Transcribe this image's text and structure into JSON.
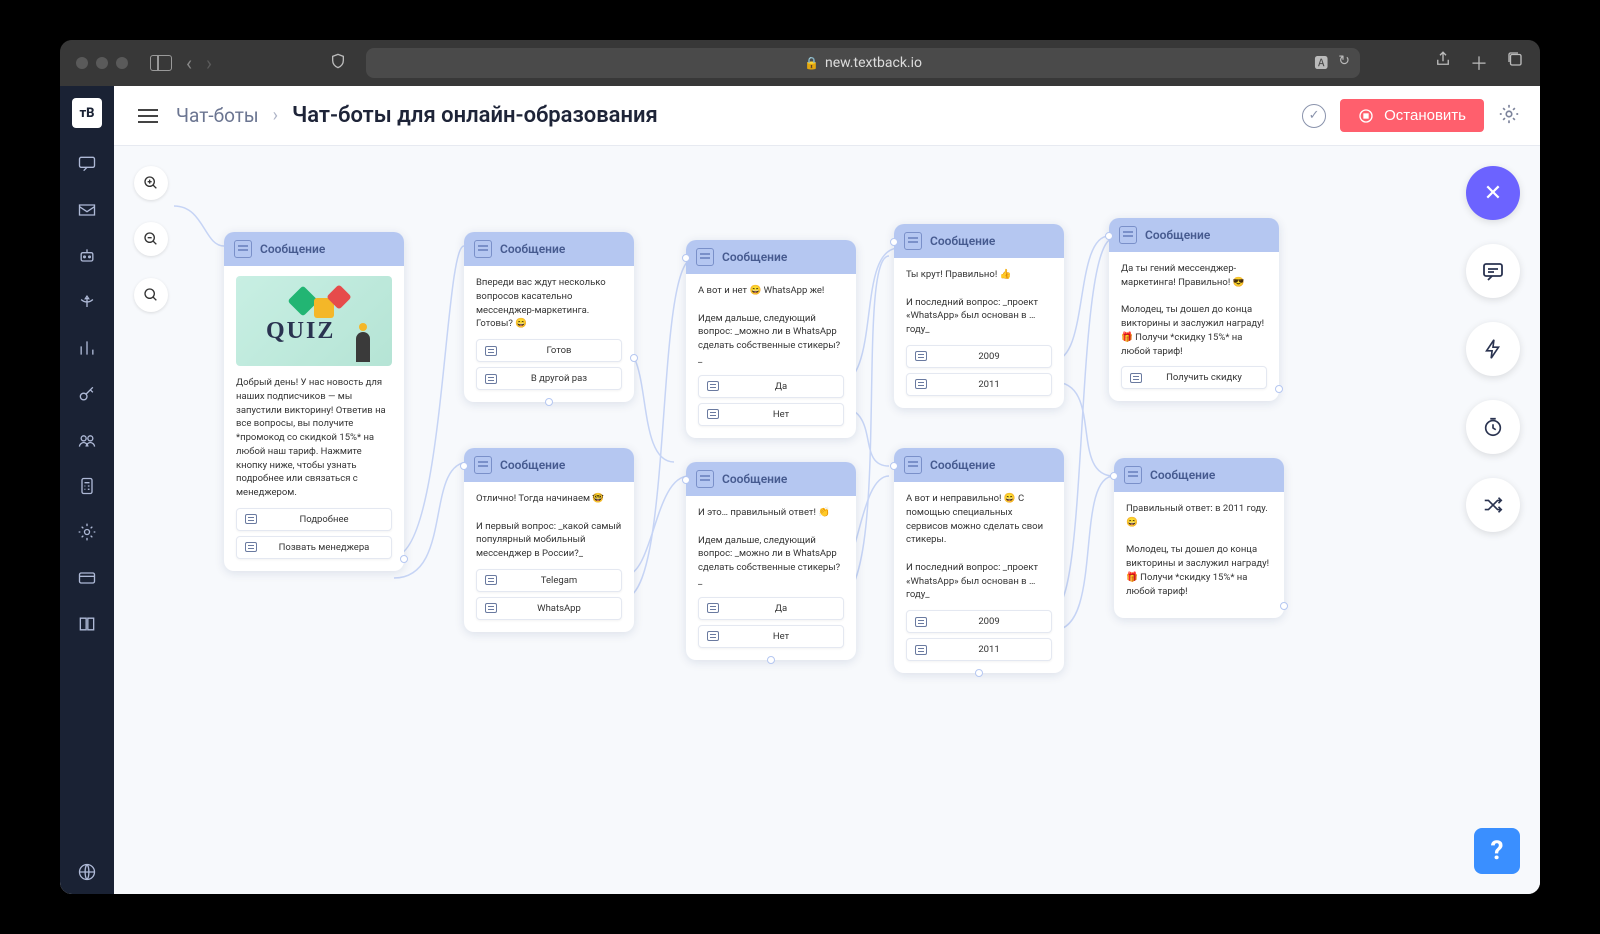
{
  "browser": {
    "url": "new.textback.io"
  },
  "header": {
    "crumb_root": "Чат-боты",
    "crumb_title": "Чат-боты для онлайн-образования",
    "stop_label": "Остановить"
  },
  "nodes": {
    "n1": {
      "title": "Сообщение",
      "has_quiz_image": true,
      "quiz_label": "QUIZ",
      "text": "Добрый день! У нас новость для наших подписчиков — мы запустили викторину! Ответив на все вопросы, вы получите *промокод со скидкой 15%* на любой наш тариф. Нажмите кнопку ниже, чтобы узнать подробнее или связаться с менеджером.",
      "buttons": [
        "Подробнее",
        "Позвать менеджера"
      ]
    },
    "n2": {
      "title": "Сообщение",
      "text": "Впереди вас ждут несколько вопросов касательно мессенджер-маркетинга. Готовы? 😄",
      "buttons": [
        "Готов",
        "В другой раз"
      ]
    },
    "n3": {
      "title": "Сообщение",
      "text": "Отлично! Тогда начинаем 🤓\n\nИ первый вопрос: _какой самый популярный мобильный мессенджер в России?_",
      "buttons": [
        "Telegam",
        "WhatsApp"
      ]
    },
    "n4": {
      "title": "Сообщение",
      "text": "А вот и нет 😄 WhatsApp же!\n\nИдем дальше, следующий вопрос: _можно ли в WhatsApp сделать собственные стикеры?_",
      "buttons": [
        "Да",
        "Нет"
      ]
    },
    "n5": {
      "title": "Сообщение",
      "text": "И это… правильный ответ! 👏\n\nИдем дальше, следующий вопрос: _можно ли в WhatsApp сделать собственные стикеры?_",
      "buttons": [
        "Да",
        "Нет"
      ]
    },
    "n6": {
      "title": "Сообщение",
      "text": "Ты крут! Правильно! 👍\n\nИ последний вопрос: _проект «WhatsApp» был основан в … году_",
      "buttons": [
        "2009",
        "2011"
      ]
    },
    "n7": {
      "title": "Сообщение",
      "text": "А вот и неправильно! 😄 С помощью специальных сервисов можно сделать свои стикеры.\n\nИ последний вопрос: _проект «WhatsApp» был основан в … году_",
      "buttons": [
        "2009",
        "2011"
      ]
    },
    "n8": {
      "title": "Сообщение",
      "text": "Да ты гений мессенджер-маркетинга! Правильно! 😎\n\nМолодец, ты дошел до конца викторины и заслужил награду! 🎁 Получи *скидку 15%* на любой тариф!",
      "buttons": [
        "Получить скидку"
      ]
    },
    "n9": {
      "title": "Сообщение",
      "text": "Правильный ответ: в 2011 году. 😄\n\nМолодец, ты дошел до конца викторины и заслужил награду! 🎁 Получи *скидку 15%* на любой тариф!",
      "buttons": []
    }
  }
}
